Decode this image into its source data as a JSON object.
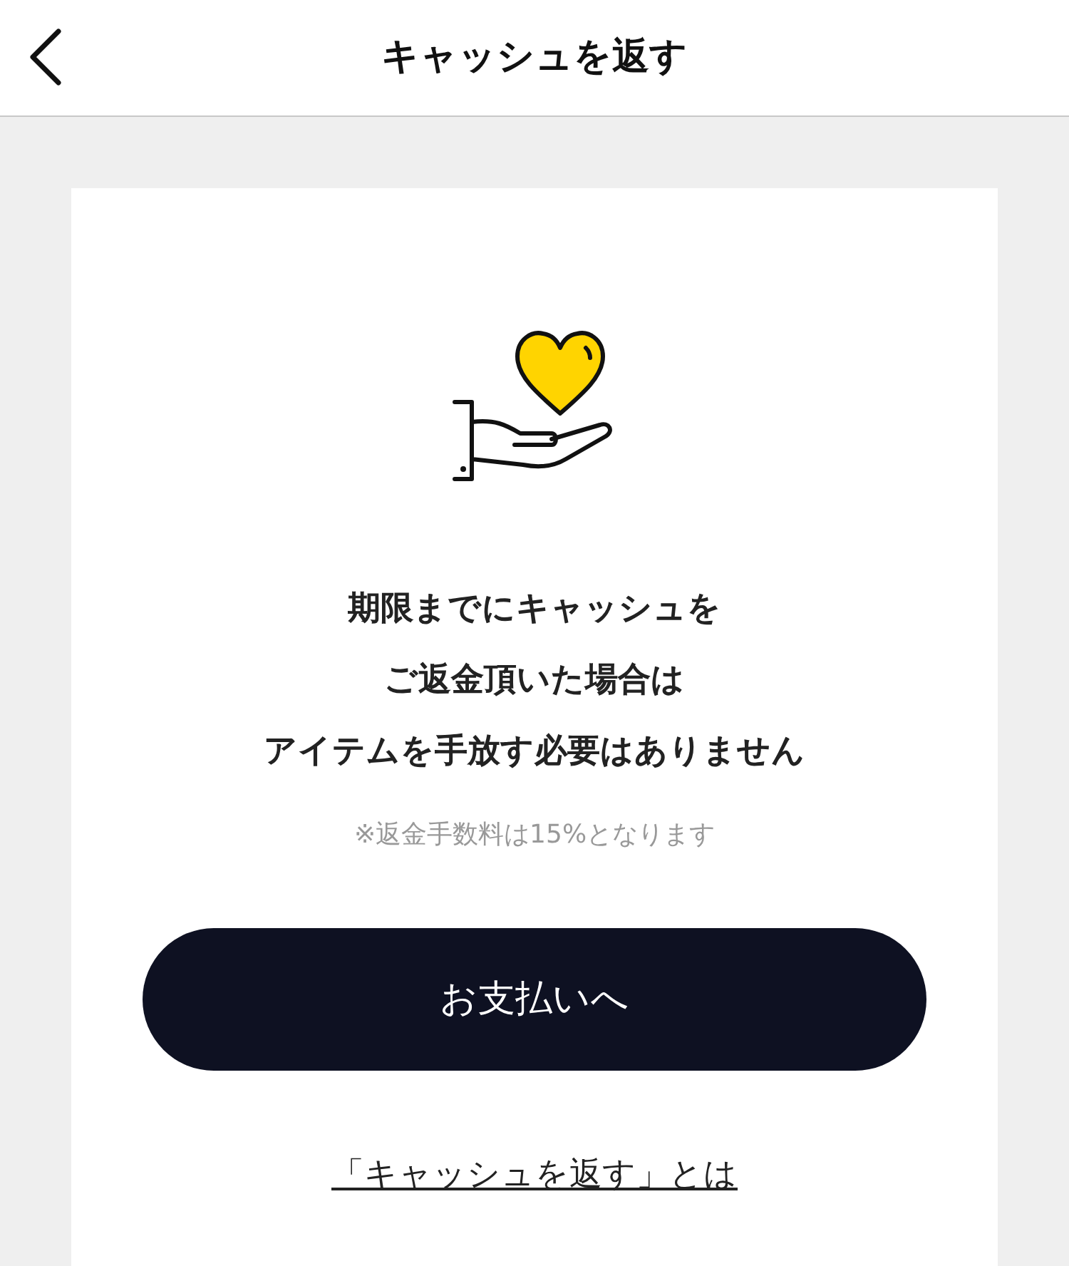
{
  "header": {
    "title": "キャッシュを返す"
  },
  "message_lines": [
    "期限までにキャッシュを",
    "ご返金頂いた場合は",
    "アイテムを手放す必要はありません"
  ],
  "note": "※返金手数料は15%となります",
  "primary_button": "お支払いへ",
  "help_link": "「キャッシュを返す」とは"
}
